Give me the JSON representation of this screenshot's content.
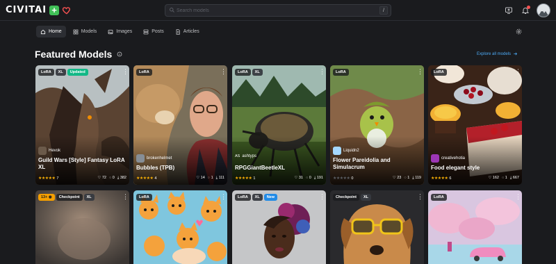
{
  "brand": {
    "name": "CIVITAI",
    "plus": "+"
  },
  "search": {
    "placeholder": "Search models",
    "shortcut": "/"
  },
  "nav": {
    "tabs": [
      "Home",
      "Models",
      "Images",
      "Posts",
      "Articles"
    ],
    "active": "Home"
  },
  "section": {
    "title": "Featured Models",
    "explore_label": "Explore all models"
  },
  "cards": [
    {
      "badges": [
        "LoRA",
        "XL",
        "Updated"
      ],
      "creator": "Hevok",
      "title": "Guild Wars [Style] Fantasy LoRA XL",
      "rating_count": "7",
      "likes": "72",
      "comments": "0",
      "downloads": "382",
      "rating": 5
    },
    {
      "badges": [
        "LoRA"
      ],
      "creator": "brokenhelmet",
      "title": "Bubbles (TPB)",
      "rating_count": "4",
      "likes": "14",
      "comments": "1",
      "downloads": "111",
      "rating": 5
    },
    {
      "badges": [
        "LoRA",
        "XL"
      ],
      "creator": "ashtyps",
      "creator_prefix": "AS",
      "title": "RPGGiantBeetleXL",
      "rating_count": "1",
      "likes": "31",
      "comments": "0",
      "downloads": "191",
      "rating": 5
    },
    {
      "badges": [
        "LoRA"
      ],
      "creator": "Liquidn2",
      "title": "Flower Pareidolia and Simulacrum",
      "rating_count": "0",
      "likes": "23",
      "comments": "1",
      "downloads": "119",
      "rating": 0
    },
    {
      "badges": [
        "LoRA"
      ],
      "creator": "creativehotia",
      "title": "Food elegant style",
      "rating_count": "6",
      "likes": "162",
      "comments": "1",
      "downloads": "667",
      "rating": 5
    },
    {
      "badges": [
        "13+",
        "Checkpoint",
        "XL"
      ],
      "creator": "",
      "title": ""
    },
    {
      "badges": [
        "LoRA"
      ],
      "creator": "",
      "title": ""
    },
    {
      "badges": [
        "LoRA",
        "XL",
        "New"
      ],
      "creator": "",
      "title": ""
    },
    {
      "badges": [
        "Checkpoint",
        "XL"
      ],
      "creator": "",
      "title": ""
    },
    {
      "badges": [
        "LoRA"
      ],
      "creator": "",
      "title": ""
    }
  ],
  "colors": {
    "accent": "#4dabf7",
    "updated": "#12b886",
    "new": "#228be6",
    "star": "#fab005",
    "brand_plus": "#40c057",
    "heart": "#fa5252"
  },
  "icons": [
    "search-icon",
    "home-icon",
    "models-icon",
    "images-icon",
    "posts-icon",
    "articles-icon",
    "settings-icon",
    "info-icon",
    "arrow-right-icon",
    "upload-icon",
    "bell-icon",
    "heart-icon",
    "more-icon",
    "like-icon",
    "comment-icon",
    "download-icon",
    "eye-icon"
  ]
}
